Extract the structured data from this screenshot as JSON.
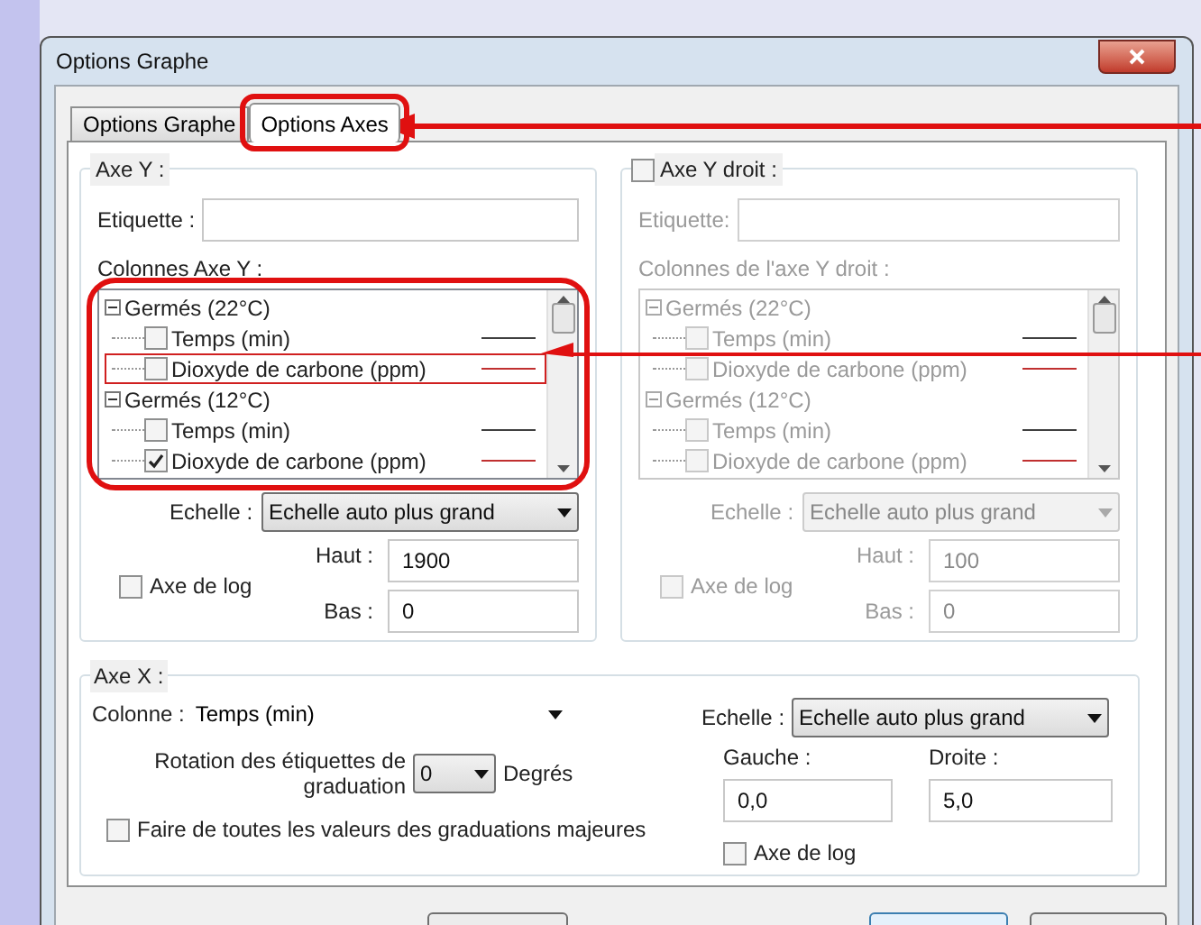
{
  "window": {
    "title": "Options Graphe"
  },
  "tabs": [
    {
      "label": "Options Graphe",
      "selected": false,
      "annotated": false
    },
    {
      "label": "Options Axes",
      "selected": true,
      "annotated": true
    }
  ],
  "axe_y": {
    "title": "Axe Y :",
    "label_field": {
      "label": "Etiquette :"
    },
    "columns_label": "Colonnes Axe Y :",
    "columns_annotated": true,
    "tree": [
      {
        "label": "Germés (22°C)",
        "expanded": true,
        "children": [
          {
            "label": "Temps (min)",
            "checked": false,
            "color": "#404040",
            "annotated": false
          },
          {
            "label": "Dioxyde de carbone (ppm)",
            "checked": false,
            "color": "#c03030",
            "annotated": true
          }
        ]
      },
      {
        "label": "Germés (12°C)",
        "expanded": true,
        "children": [
          {
            "label": "Temps (min)",
            "checked": false,
            "color": "#404040",
            "annotated": false
          },
          {
            "label": "Dioxyde de carbone (ppm)",
            "checked": true,
            "color": "#c03030",
            "annotated": false
          }
        ]
      }
    ],
    "scale": {
      "label": "Echelle :",
      "value": "Echelle auto plus grand"
    },
    "log_axis": {
      "label": "Axe de log",
      "checked": false
    },
    "high": {
      "label": "Haut :",
      "value": "1900"
    },
    "low": {
      "label": "Bas :",
      "value": "0"
    }
  },
  "axe_y_right": {
    "title": "Axe Y droit :",
    "checked": false,
    "label_field": {
      "label": "Etiquette:"
    },
    "columns_label": "Colonnes de l'axe Y droit :",
    "tree": [
      {
        "label": "Germés (22°C)",
        "expanded": true,
        "children": [
          {
            "label": "Temps (min)",
            "checked": false,
            "color": "#404040",
            "annotated": false
          },
          {
            "label": "Dioxyde de carbone (ppm)",
            "checked": false,
            "color": "#c03030",
            "annotated": false
          }
        ]
      },
      {
        "label": "Germés (12°C)",
        "expanded": true,
        "children": [
          {
            "label": "Temps (min)",
            "checked": false,
            "color": "#404040",
            "annotated": false
          },
          {
            "label": "Dioxyde de carbone (ppm)",
            "checked": false,
            "color": "#c03030",
            "annotated": false
          }
        ]
      }
    ],
    "scale": {
      "label": "Echelle :",
      "value": "Echelle auto plus grand"
    },
    "log_axis": {
      "label": "Axe de log",
      "checked": false
    },
    "high": {
      "label": "Haut :",
      "value": "100"
    },
    "low": {
      "label": "Bas :",
      "value": "0"
    }
  },
  "axe_x": {
    "title": "Axe X :",
    "column": {
      "label": "Colonne :",
      "value": "Temps (min)"
    },
    "rotation": {
      "label": "Rotation des étiquettes de graduation",
      "value": "0",
      "unit": "Degrés"
    },
    "major_values": {
      "label": "Faire de toutes les valeurs des graduations majeures",
      "checked": false
    },
    "scale": {
      "label": "Echelle :",
      "value": "Echelle auto plus grand"
    },
    "left": {
      "label": "Gauche :",
      "value": "0,0"
    },
    "right": {
      "label": "Droite :",
      "value": "5,0"
    },
    "log_axis": {
      "label": "Axe de log",
      "checked": false
    }
  }
}
